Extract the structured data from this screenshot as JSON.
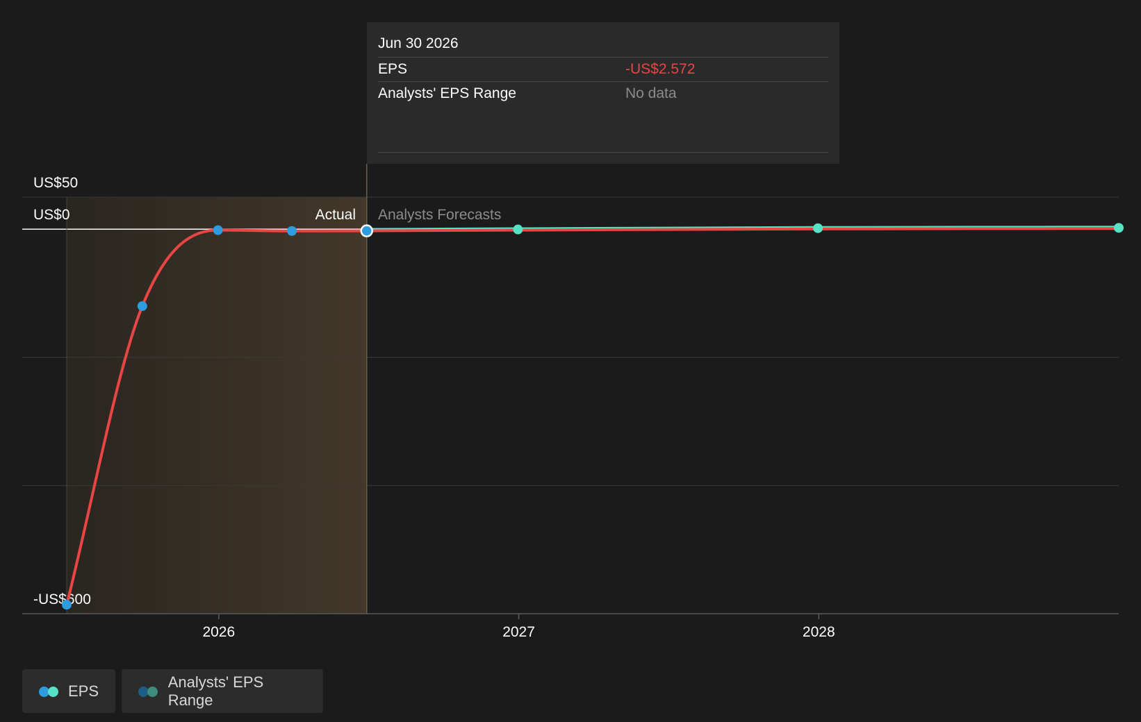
{
  "tooltip": {
    "date": "Jun 30 2026",
    "rows": [
      {
        "label": "EPS",
        "value": "-US$2.572"
      },
      {
        "label": "Analysts' EPS Range",
        "value": "No data"
      }
    ]
  },
  "regions": {
    "actual_label": "Actual",
    "forecast_label": "Analysts Forecasts"
  },
  "legend": {
    "items": [
      {
        "label": "EPS",
        "colors": [
          "#2d9de0",
          "#57e2c6"
        ]
      },
      {
        "label": "Analysts' EPS Range",
        "colors": [
          "#1e5e84",
          "#3e8c7b"
        ]
      }
    ]
  },
  "colors": {
    "background": "#1b1b1b",
    "eps_line": "#e84545",
    "forecast_line": "#57e2c6",
    "actual_point": "#2d9de0",
    "forecast_point": "#57e2c6",
    "actual_region": "#433829",
    "negative_value": "#e84545"
  },
  "chart_data": {
    "type": "line",
    "title": "",
    "xlabel": "",
    "ylabel": "",
    "x_ticks": [
      "2026",
      "2027",
      "2028"
    ],
    "y_ticks": [
      {
        "value": 50,
        "label": "US$50"
      },
      {
        "value": 0,
        "label": "US$0"
      },
      {
        "value": -600,
        "label": "-US$600"
      }
    ],
    "ylim": [
      -600,
      50
    ],
    "xlim": [
      "2025-06-30",
      "2028-12-31"
    ],
    "actual_end": "2026-06-30",
    "selected": "2026-06-30",
    "series": [
      {
        "name": "EPS",
        "kind": "actual",
        "points": [
          {
            "x": "2025-06-30",
            "y": -586
          },
          {
            "x": "2025-09-30",
            "y": -120
          },
          {
            "x": "2025-12-31",
            "y": -1.5
          },
          {
            "x": "2026-03-31",
            "y": -2.8
          },
          {
            "x": "2026-06-30",
            "y": -2.572
          }
        ]
      },
      {
        "name": "EPS",
        "kind": "forecast",
        "points": [
          {
            "x": "2026-06-30",
            "y": -2.572
          },
          {
            "x": "2026-12-31",
            "y": -1.5
          },
          {
            "x": "2027-12-31",
            "y": 0.5
          },
          {
            "x": "2028-12-31",
            "y": 1.0
          }
        ]
      }
    ]
  }
}
